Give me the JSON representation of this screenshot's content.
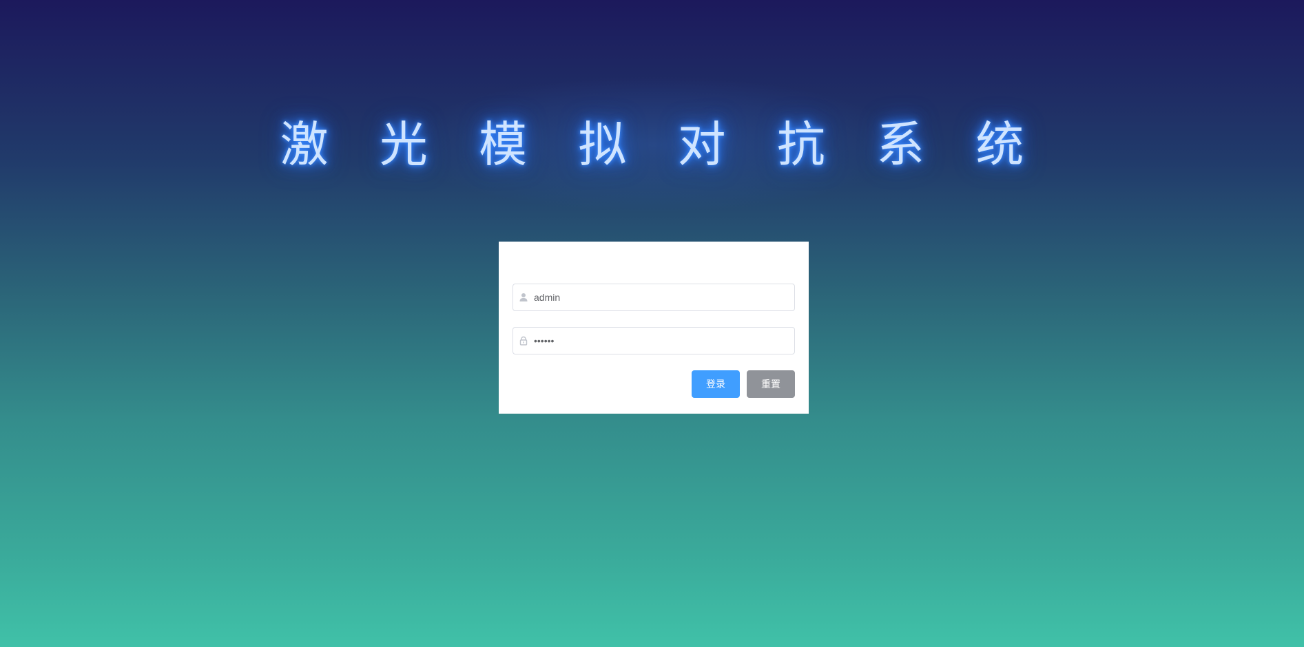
{
  "title": "激 光 模 拟 对 抗 系 统",
  "login_form": {
    "username": {
      "value": "admin",
      "icon": "user-icon"
    },
    "password": {
      "value": "••••••",
      "icon": "lock-icon"
    },
    "login_button": "登录",
    "reset_button": "重置"
  },
  "colors": {
    "primary": "#409eff",
    "secondary": "#909399",
    "title_glow": "#2f7cf6"
  }
}
